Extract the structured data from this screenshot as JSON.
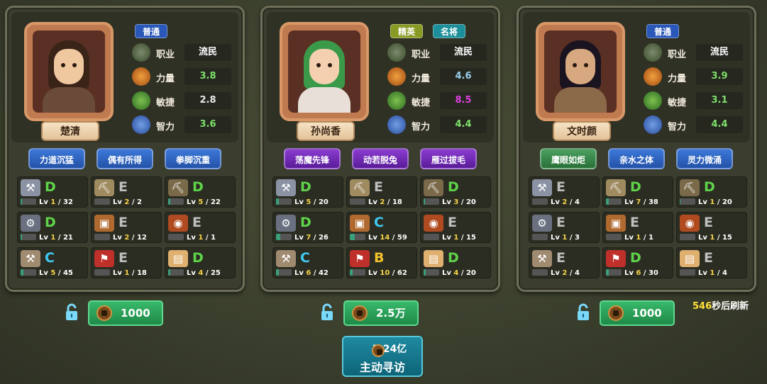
{
  "cards": [
    {
      "name": "楚清",
      "badges": [
        {
          "label": "普通",
          "style": "blue"
        }
      ],
      "stats": [
        {
          "label": "职业",
          "value": "流民",
          "color": "#ffffff",
          "icon": "soldier-icon"
        },
        {
          "label": "力量",
          "value": "3.8",
          "color": "#7ee06a",
          "icon": "strength-icon"
        },
        {
          "label": "敏捷",
          "value": "2.8",
          "color": "#e8e8e8",
          "icon": "agility-icon"
        },
        {
          "label": "智力",
          "value": "3.6",
          "color": "#7ee06a",
          "icon": "intellect-icon"
        }
      ],
      "traits": [
        {
          "label": "力道沉猛",
          "style": "blue"
        },
        {
          "label": "偶有所得",
          "style": "blue"
        },
        {
          "label": "拳脚沉重",
          "style": "blue"
        }
      ],
      "skills": [
        {
          "icon": "axe-icon",
          "grade": "D",
          "lv": "1",
          "max": "32",
          "progress": 0.1
        },
        {
          "icon": "shovel-icon",
          "grade": "E",
          "lv": "2",
          "max": "2",
          "progress": 0.0
        },
        {
          "icon": "pickaxe-icon",
          "grade": "D",
          "lv": "5",
          "max": "22",
          "progress": 0.15
        },
        {
          "icon": "anvil-icon",
          "grade": "D",
          "lv": "1",
          "max": "21",
          "progress": 0.1
        },
        {
          "icon": "workbench-icon",
          "grade": "E",
          "lv": "2",
          "max": "12",
          "progress": 0.0
        },
        {
          "icon": "cauldron-icon",
          "grade": "E",
          "lv": "1",
          "max": "1",
          "progress": 0.0
        },
        {
          "icon": "hammer-icon",
          "grade": "C",
          "lv": "5",
          "max": "45",
          "progress": 0.2
        },
        {
          "icon": "banner-icon",
          "grade": "E",
          "lv": "1",
          "max": "18",
          "progress": 0.0
        },
        {
          "icon": "book-icon",
          "grade": "D",
          "lv": "4",
          "max": "25",
          "progress": 0.15
        }
      ],
      "cost": "1000"
    },
    {
      "name": "孙尚香",
      "badges": [
        {
          "label": "精英",
          "style": "olive"
        },
        {
          "label": "名将",
          "style": "teal"
        }
      ],
      "stats": [
        {
          "label": "职业",
          "value": "流民",
          "color": "#ffffff",
          "icon": "soldier-icon"
        },
        {
          "label": "力量",
          "value": "4.6",
          "color": "#9ad0f0",
          "icon": "strength-icon"
        },
        {
          "label": "敏捷",
          "value": "8.5",
          "color": "#e040e0",
          "icon": "agility-icon"
        },
        {
          "label": "智力",
          "value": "4.4",
          "color": "#7ee06a",
          "icon": "intellect-icon"
        }
      ],
      "traits": [
        {
          "label": "荡魔先锋",
          "style": "purple"
        },
        {
          "label": "动若脱兔",
          "style": "purple"
        },
        {
          "label": "雁过拔毛",
          "style": "purple"
        }
      ],
      "skills": [
        {
          "icon": "axe-icon",
          "grade": "D",
          "lv": "5",
          "max": "20",
          "progress": 0.2
        },
        {
          "icon": "shovel-icon",
          "grade": "E",
          "lv": "2",
          "max": "18",
          "progress": 0.0
        },
        {
          "icon": "pickaxe-icon",
          "grade": "D",
          "lv": "3",
          "max": "20",
          "progress": 0.1
        },
        {
          "icon": "anvil-icon",
          "grade": "D",
          "lv": "7",
          "max": "26",
          "progress": 0.25
        },
        {
          "icon": "workbench-icon",
          "grade": "C",
          "lv": "14",
          "max": "59",
          "progress": 0.3
        },
        {
          "icon": "cauldron-icon",
          "grade": "E",
          "lv": "1",
          "max": "15",
          "progress": 0.0
        },
        {
          "icon": "hammer-icon",
          "grade": "C",
          "lv": "6",
          "max": "42",
          "progress": 0.2
        },
        {
          "icon": "banner-icon",
          "grade": "B",
          "lv": "10",
          "max": "62",
          "progress": 0.2
        },
        {
          "icon": "book-icon",
          "grade": "D",
          "lv": "4",
          "max": "20",
          "progress": 0.15
        }
      ],
      "cost": "2.5万"
    },
    {
      "name": "文时颜",
      "badges": [
        {
          "label": "普通",
          "style": "blue"
        }
      ],
      "stats": [
        {
          "label": "职业",
          "value": "流民",
          "color": "#ffffff",
          "icon": "soldier-icon"
        },
        {
          "label": "力量",
          "value": "3.9",
          "color": "#7ee06a",
          "icon": "strength-icon"
        },
        {
          "label": "敏捷",
          "value": "3.1",
          "color": "#7ee06a",
          "icon": "agility-icon"
        },
        {
          "label": "智力",
          "value": "4.4",
          "color": "#7ee06a",
          "icon": "intellect-icon"
        }
      ],
      "traits": [
        {
          "label": "鹰眼如炬",
          "style": "green"
        },
        {
          "label": "亲水之体",
          "style": "blue"
        },
        {
          "label": "灵力微涌",
          "style": "blue"
        }
      ],
      "skills": [
        {
          "icon": "axe-icon",
          "grade": "E",
          "lv": "2",
          "max": "4",
          "progress": 0.0
        },
        {
          "icon": "shovel-icon",
          "grade": "D",
          "lv": "7",
          "max": "38",
          "progress": 0.2
        },
        {
          "icon": "pickaxe-icon",
          "grade": "D",
          "lv": "1",
          "max": "20",
          "progress": 0.05
        },
        {
          "icon": "anvil-icon",
          "grade": "E",
          "lv": "1",
          "max": "3",
          "progress": 0.0
        },
        {
          "icon": "workbench-icon",
          "grade": "E",
          "lv": "1",
          "max": "1",
          "progress": 0.0
        },
        {
          "icon": "cauldron-icon",
          "grade": "E",
          "lv": "1",
          "max": "15",
          "progress": 0.0
        },
        {
          "icon": "hammer-icon",
          "grade": "E",
          "lv": "2",
          "max": "4",
          "progress": 0.0
        },
        {
          "icon": "banner-icon",
          "grade": "D",
          "lv": "6",
          "max": "30",
          "progress": 0.2
        },
        {
          "icon": "book-icon",
          "grade": "E",
          "lv": "1",
          "max": "4",
          "progress": 0.0
        }
      ],
      "cost": "1000"
    }
  ],
  "refresh": {
    "seconds": "546",
    "suffix": "秒后刷新"
  },
  "visit": {
    "cost": "5.24亿",
    "label": "主动寻访"
  }
}
